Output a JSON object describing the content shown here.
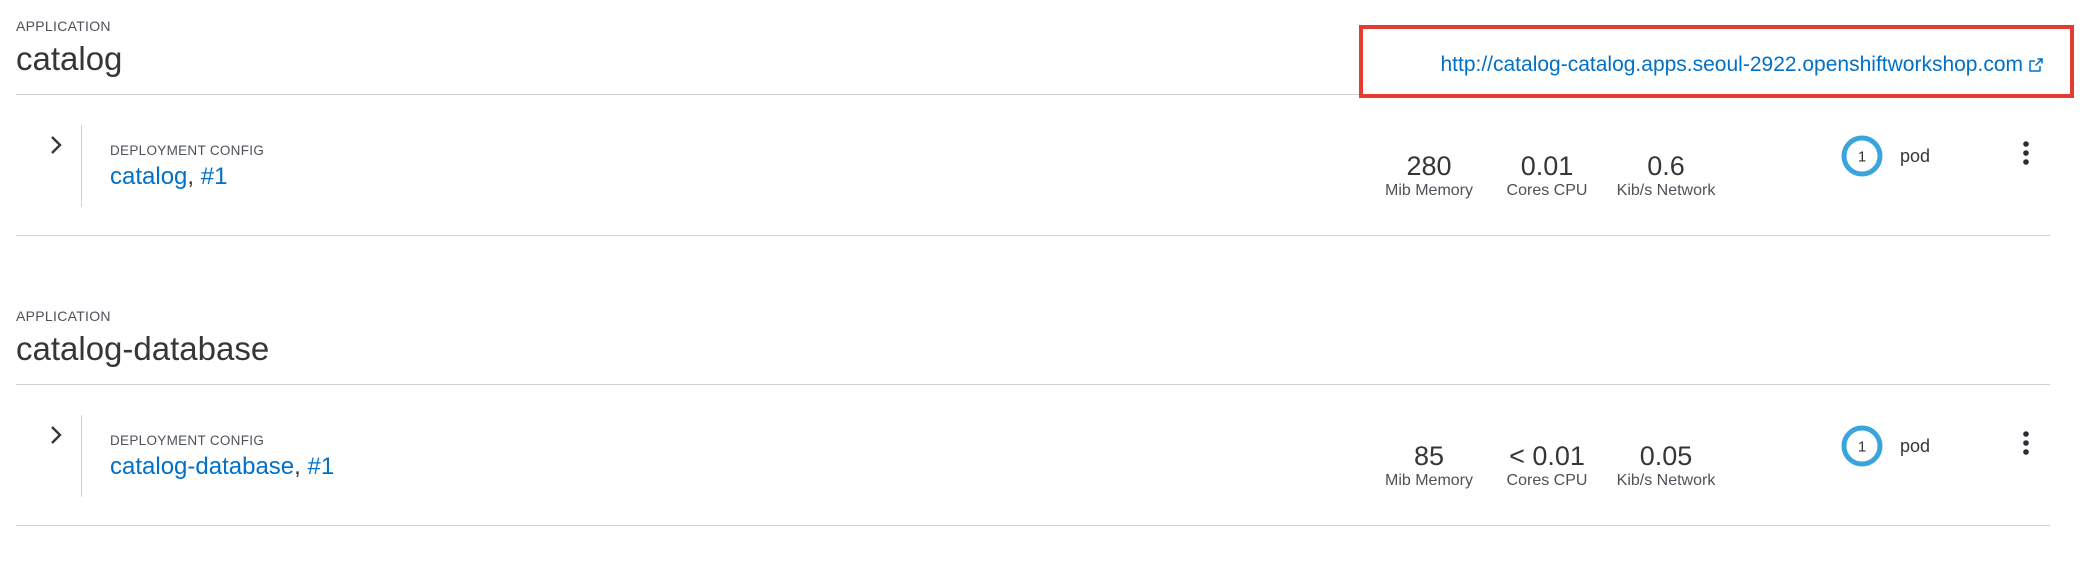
{
  "applications": [
    {
      "eyebrow": "APPLICATION",
      "name": "catalog",
      "route": {
        "url": "http://catalog-catalog.apps.seoul-2922.openshiftworkshop.com",
        "highlighted": true,
        "highlight_color": "#e53b30"
      },
      "deployment": {
        "eyebrow": "DEPLOYMENT CONFIG",
        "name": "catalog",
        "separator": ", ",
        "revision": "#1",
        "metrics": [
          {
            "value": "280",
            "label": "Mib Memory"
          },
          {
            "value": "0.01",
            "label": "Cores CPU"
          },
          {
            "value": "0.6",
            "label": "Kib/s Network"
          }
        ],
        "pods": {
          "count": "1",
          "label": "pod"
        }
      }
    },
    {
      "eyebrow": "APPLICATION",
      "name": "catalog-database",
      "deployment": {
        "eyebrow": "DEPLOYMENT CONFIG",
        "name": "catalog-database",
        "separator": ", ",
        "revision": "#1",
        "metrics": [
          {
            "value": "85",
            "label": "Mib Memory"
          },
          {
            "value": "< 0.01",
            "label": "Cores CPU"
          },
          {
            "value": "0.05",
            "label": "Kib/s Network"
          }
        ],
        "pods": {
          "count": "1",
          "label": "pod"
        }
      }
    }
  ],
  "icons": {
    "expander": "chevron-right-icon",
    "external": "external-link-icon",
    "menu": "kebab-menu-icon",
    "pod_ring": "pod-donut-icon"
  },
  "colors": {
    "link": "#0070c8",
    "pod_ring": "#39a5dc",
    "divider": "#d1d1d1"
  }
}
